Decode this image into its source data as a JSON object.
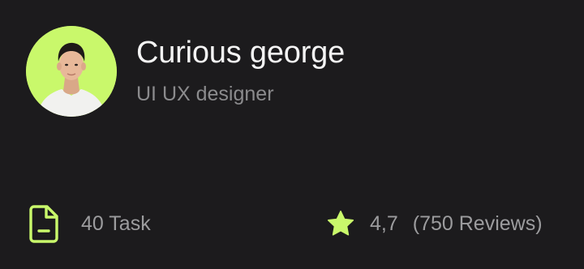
{
  "profile": {
    "name": "Curious george",
    "role": "UI UX designer",
    "avatar_bg": "#c9f86b"
  },
  "stats": {
    "task": {
      "icon": "document-icon",
      "label": "40 Task"
    },
    "rating": {
      "icon": "star-icon",
      "value": "4,7",
      "reviews": "(750 Reviews)"
    }
  },
  "colors": {
    "background": "#1c1b1d",
    "accent": "#c9f86b",
    "name_text": "#f4f4f4",
    "muted_text": "#8b8b8d"
  }
}
